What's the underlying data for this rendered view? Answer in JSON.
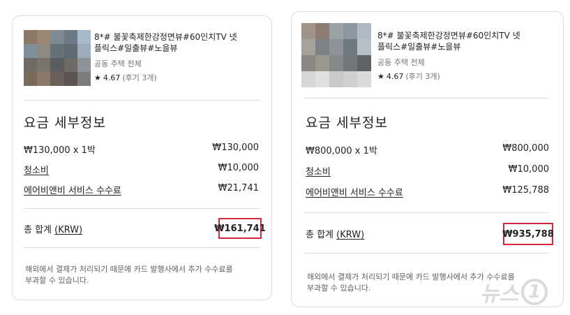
{
  "cards": [
    {
      "title_lines": [
        "8*# 불꽃축제한강정면뷰#60인치TV 넷",
        "플릭스#일출뷰#노을뷰"
      ],
      "subtitle": "공동 주택 전체",
      "rating": "4.67",
      "reviews": "(후기 3개)",
      "section_title": "요금 세부정보",
      "rows": [
        {
          "label": "₩130,000 x 1박",
          "value": "₩130,000"
        },
        {
          "label": "청소비",
          "value": "₩10,000"
        },
        {
          "label": "에어비앤비 서비스 수수료",
          "value": "₩21,741"
        }
      ],
      "total_label": "총 합계",
      "total_currency": "(KRW)",
      "total_value": "₩161,741",
      "note_lines": [
        "해외에서 결제가 처리되기 때문에 카드 발행사에서 추가 수수료를",
        "부과할 수 있습니다."
      ],
      "thumb_colors": [
        "#8c7866",
        "#9a8672",
        "#7d8a92",
        "#6c7a86",
        "#a8bac8",
        "#7f8f9c",
        "#8a8a82",
        "#66727a",
        "#5f6b72",
        "#9cacba",
        "#6f6a64",
        "#7a746c",
        "#5a5e60",
        "#6e6a66",
        "#8a949a",
        "#7a6a5c",
        "#8a7868",
        "#6a6058",
        "#5c5450",
        "#7c7c7c"
      ]
    },
    {
      "title_lines": [
        "8*# 불꽃축제한강정면뷰#60인치TV 넷",
        "플릭스#일출뷰#노을뷰"
      ],
      "subtitle": "공동 주택 전체",
      "rating": "4.67",
      "reviews": "(후기 3개)",
      "section_title": "요금 세부정보",
      "rows": [
        {
          "label": "₩800,000 x 1박",
          "value": "₩800,000"
        },
        {
          "label": "청소비",
          "value": "₩10,000"
        },
        {
          "label": "에어비앤비 서비스 수수료",
          "value": "₩125,788"
        }
      ],
      "total_label": "총 합계",
      "total_currency": "(KRW)",
      "total_value": "₩935,788",
      "note_lines": [
        "해외에서 결제가 처리되기 때문에 카드 발행사에서 추가 수수료를",
        "부과할 수 있습니다."
      ],
      "thumb_colors": [
        "#a0948a",
        "#8e7c70",
        "#9aa2a6",
        "#8b98a2",
        "#aeb9c4",
        "#a4a09a",
        "#7c8286",
        "#8e9296",
        "#6e7a82",
        "#b7c0c6",
        "#8a8784",
        "#9b968e",
        "#85898b",
        "#74777a",
        "#5f6366",
        "#d6d6d6",
        "#e0e0e0",
        "#c9c9c9",
        "#d0d0d0",
        "#dadada"
      ]
    }
  ],
  "watermark": {
    "text": "뉴스",
    "mark": "1"
  },
  "colors": {
    "highlight_border": "#d7263d",
    "divider": "#dddddd",
    "muted_text": "#717171"
  }
}
